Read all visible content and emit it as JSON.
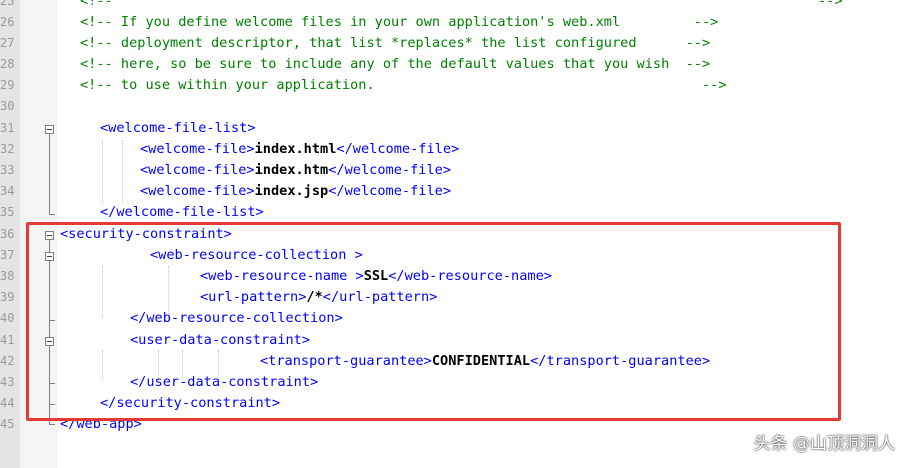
{
  "editor": {
    "line_numbers": [
      "25",
      "26",
      "27",
      "28",
      "29",
      "30",
      "31",
      "32",
      "33",
      "34",
      "35",
      "36",
      "37",
      "38",
      "39",
      "40",
      "41",
      "42",
      "43",
      "44",
      "45"
    ],
    "comments": [
      "<!--",
      "<!-- If you define welcome files in your own application's web.xml         -->",
      "<!-- deployment descriptor, that list *replaces* the list configured      -->",
      "<!-- here, so be sure to include any of the default values that you wish  -->",
      "<!-- to use within your application.                                        -->"
    ],
    "comment_end_first": "-->",
    "welcome": {
      "open": "<welcome-file-list>",
      "files": [
        "index.html",
        "index.htm",
        "index.jsp"
      ],
      "file_open": "<welcome-file>",
      "file_close": "</welcome-file>",
      "close": "</welcome-file-list>"
    },
    "security": {
      "open": "<security-constraint>",
      "collection_open": "<web-resource-collection >",
      "name_open": "<web-resource-name >",
      "name_value": "SSL",
      "name_close": "</web-resource-name>",
      "url_open": "<url-pattern>",
      "url_value": "/*",
      "url_close": "</url-pattern>",
      "collection_close": "</web-resource-collection>",
      "udc_open": "<user-data-constraint>",
      "tg_open": "<transport-guarantee>",
      "tg_value": "CONFIDENTIAL",
      "tg_close": "</transport-guarantee>",
      "udc_close": "</user-data-constraint>",
      "close": "</security-constraint>"
    },
    "webapp_close": "</web-app>"
  },
  "watermark": "头条 @山顶洞洞人",
  "colors": {
    "comment": "#008000",
    "tag": "#0000ff",
    "highlight": "#e53935"
  }
}
